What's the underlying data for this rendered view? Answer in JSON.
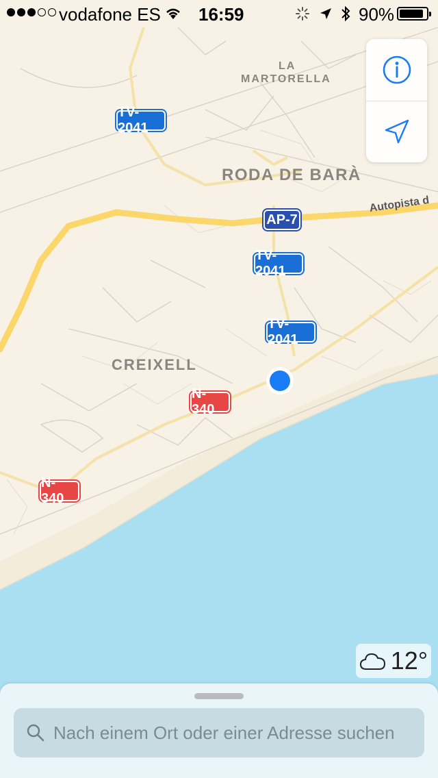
{
  "status_bar": {
    "carrier": "vodafone ES",
    "time": "16:59",
    "battery_percent": "90%",
    "battery_level": 0.9,
    "signal_strength": 3,
    "signal_max": 5
  },
  "map": {
    "places": [
      "LA",
      "MARTORELLA",
      "RODA DE BARÀ",
      "CREIXELL"
    ],
    "road_labels": {
      "tv2041_a": "TV-2041",
      "tv2041_b": "TV-2041",
      "tv2041_c": "TV-2041",
      "ap7": "AP-7",
      "n340_a": "N-340",
      "n340_b": "N-340",
      "autopista": "Autopista d"
    },
    "colors": {
      "land": "#f7f1e6",
      "sea": "#aadff2",
      "highway": "#fbd76b",
      "shield_blue": "#1a6fd6",
      "shield_red": "#e84545",
      "user_dot": "#1a7cf5"
    }
  },
  "controls": {
    "info_icon": "info-icon",
    "location_icon": "location-arrow-icon"
  },
  "weather": {
    "icon": "cloud-icon",
    "temperature": "12°"
  },
  "search": {
    "placeholder": "Nach einem Ort oder einer Adresse suchen",
    "icon": "search-icon"
  }
}
